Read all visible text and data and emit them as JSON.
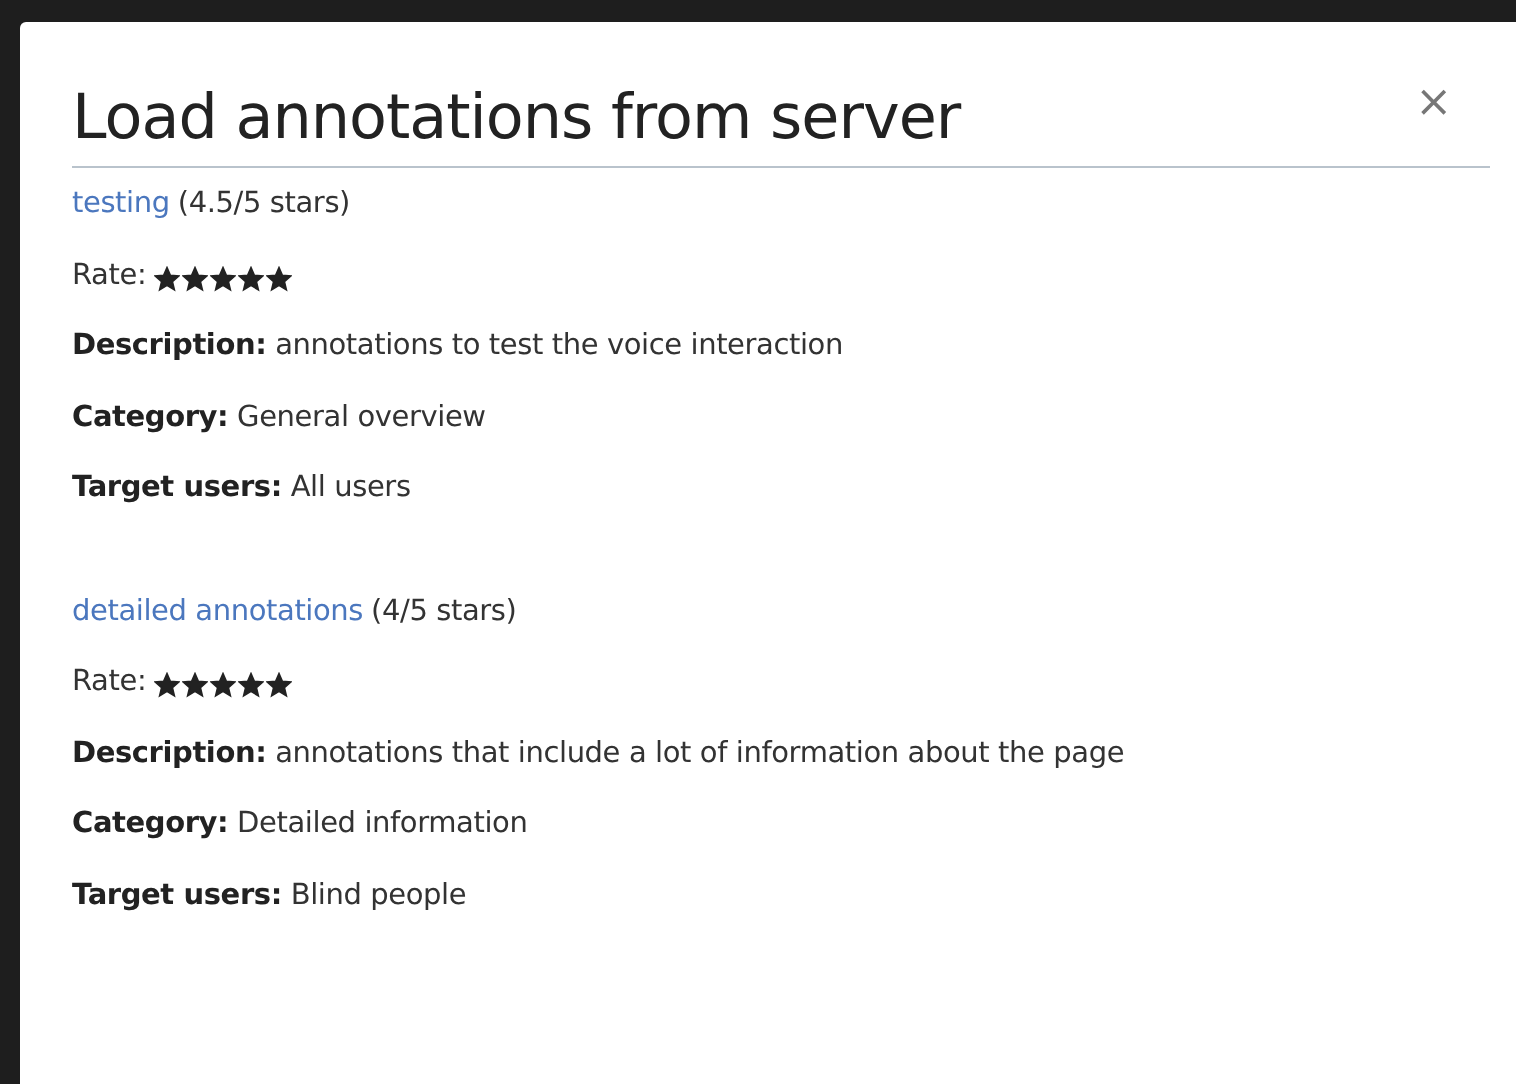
{
  "dialog": {
    "title": "Load annotations from server",
    "close": "×"
  },
  "annotations": [
    {
      "name": "testing",
      "rating": "(4.5/5 stars)",
      "rate_label": "Rate:",
      "stars": 5,
      "details": [
        "**Description:** annotations to test the voice interaction",
        "**Category:** General overview",
        "**Target users:** All users"
      ]
    },
    {
      "name": "detailed annotations",
      "rating": "(4/5 stars)",
      "rate_label": "Rate:",
      "stars": 5,
      "details": [
        "**Description:** annotations that include a lot of information about the page",
        "**Category:** Detailed information",
        "**Target users:** Blind people"
      ]
    }
  ]
}
